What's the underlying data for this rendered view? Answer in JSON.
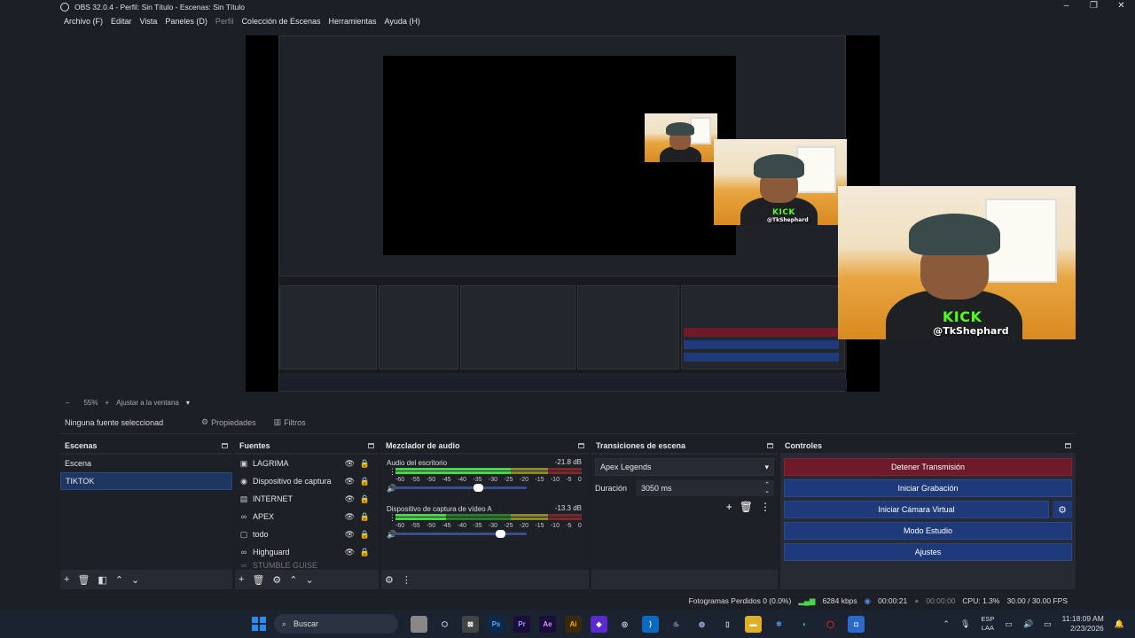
{
  "window": {
    "title": "OBS 32.0.4 - Perfil: Sin Título - Escenas: Sin Título",
    "controls": [
      "–",
      "❐",
      "✕"
    ]
  },
  "menu": [
    {
      "label": "Archivo (F)"
    },
    {
      "label": "Editar"
    },
    {
      "label": "Vista"
    },
    {
      "label": "Paneles (D)"
    },
    {
      "label": "Perfil"
    },
    {
      "label": "Colección de Escenas"
    },
    {
      "label": "Herramientas"
    },
    {
      "label": "Ayuda (H)"
    }
  ],
  "overlay": {
    "kick": "KICK",
    "handle": "@TkShephard"
  },
  "zoom": {
    "minus": "–",
    "value": "55%",
    "plus": "+",
    "fit": "Ajustar a la ventana"
  },
  "props_bar": {
    "no_source": "Ninguna fuente seleccionad",
    "properties": "Propiedades",
    "filters": "Filtros"
  },
  "scenes": {
    "title": "Escenas",
    "items": [
      {
        "label": "Escena"
      },
      {
        "label": "TIKTOK"
      }
    ]
  },
  "sources": {
    "title": "Fuentes",
    "items": [
      {
        "label": "LAGRIMA",
        "icon": "▣"
      },
      {
        "label": "Dispositivo de captura",
        "icon": "◉"
      },
      {
        "label": "INTERNET",
        "icon": "▤"
      },
      {
        "label": "APEX",
        "icon": "∞"
      },
      {
        "label": "todo",
        "icon": "▢"
      },
      {
        "label": "Highguard",
        "icon": "∞"
      },
      {
        "label": "STUMBLE GUISE",
        "icon": "∞"
      }
    ]
  },
  "mixer": {
    "title": "Mezclador de audio",
    "channels": [
      {
        "name": "Audio del escritorio",
        "db": "-21.8 dB",
        "level": 0.62
      },
      {
        "name": "Dispositivo de captura de vídeo A",
        "db": "-13.3 dB",
        "level": 0.27
      }
    ],
    "scale": [
      "-60",
      "-55",
      "-50",
      "-45",
      "-40",
      "-35",
      "-30",
      "-25",
      "-20",
      "-15",
      "-10",
      "-5",
      "0"
    ]
  },
  "transitions": {
    "title": "Transiciones de escena",
    "selected": "Apex Legends",
    "duration_label": "Duración",
    "duration_value": "3050 ms"
  },
  "controls": {
    "title": "Controles",
    "stop_stream": "Detener Transmisión",
    "start_record": "Iniciar Grabación",
    "virtual_cam": "Iniciar Cámara Virtual",
    "studio_mode": "Modo Estudio",
    "settings": "Ajustes"
  },
  "status": {
    "dropped": "Fotogramas Perdidos 0 (0.0%)",
    "bitrate": "6284 kbps",
    "stream_time": "00:00:21",
    "rec_time": "00:00:00",
    "cpu": "CPU: 1.3%",
    "fps": "30.00 / 30.00 FPS"
  },
  "taskbar": {
    "search": "Buscar",
    "lang_top": "ESP",
    "lang_bottom": "LAA",
    "time": "11:18:09 AM",
    "date": "2/23/2026"
  },
  "colors": {
    "accent": "#1f3a7a",
    "stream": "#6e1a28",
    "selection": "#1e3760",
    "kick": "#53fc18"
  }
}
